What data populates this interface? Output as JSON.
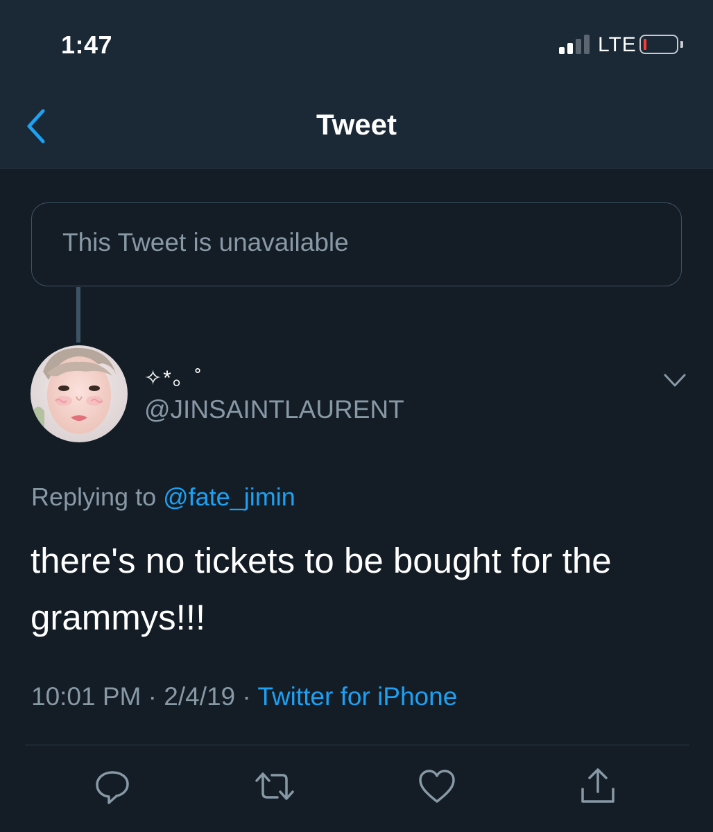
{
  "status_bar": {
    "time": "1:47",
    "network": "LTE",
    "battery_level": 0.08,
    "signal_bars": 2
  },
  "nav": {
    "title": "Tweet",
    "back_icon": "chevron-left-icon"
  },
  "quoted": {
    "text": "This Tweet is unavailable"
  },
  "tweet": {
    "display_name": "✧*。˚",
    "handle": "@JINSAINTLAURENT",
    "reply_prefix": "Replying to ",
    "reply_to": "@fate_jimin",
    "text": "there's no tickets to be bought for the grammys!!!",
    "time": "10:01 PM",
    "separator": "·",
    "date": "2/4/19",
    "source": "Twitter for iPhone"
  },
  "actions": [
    {
      "icon": "reply-icon"
    },
    {
      "icon": "retweet-icon"
    },
    {
      "icon": "like-icon"
    },
    {
      "icon": "share-icon"
    }
  ],
  "colors": {
    "background": "#141d26",
    "header": "#1b2836",
    "accent": "#1da1f2",
    "secondary_text": "#8899a6",
    "border": "#3d5466"
  }
}
